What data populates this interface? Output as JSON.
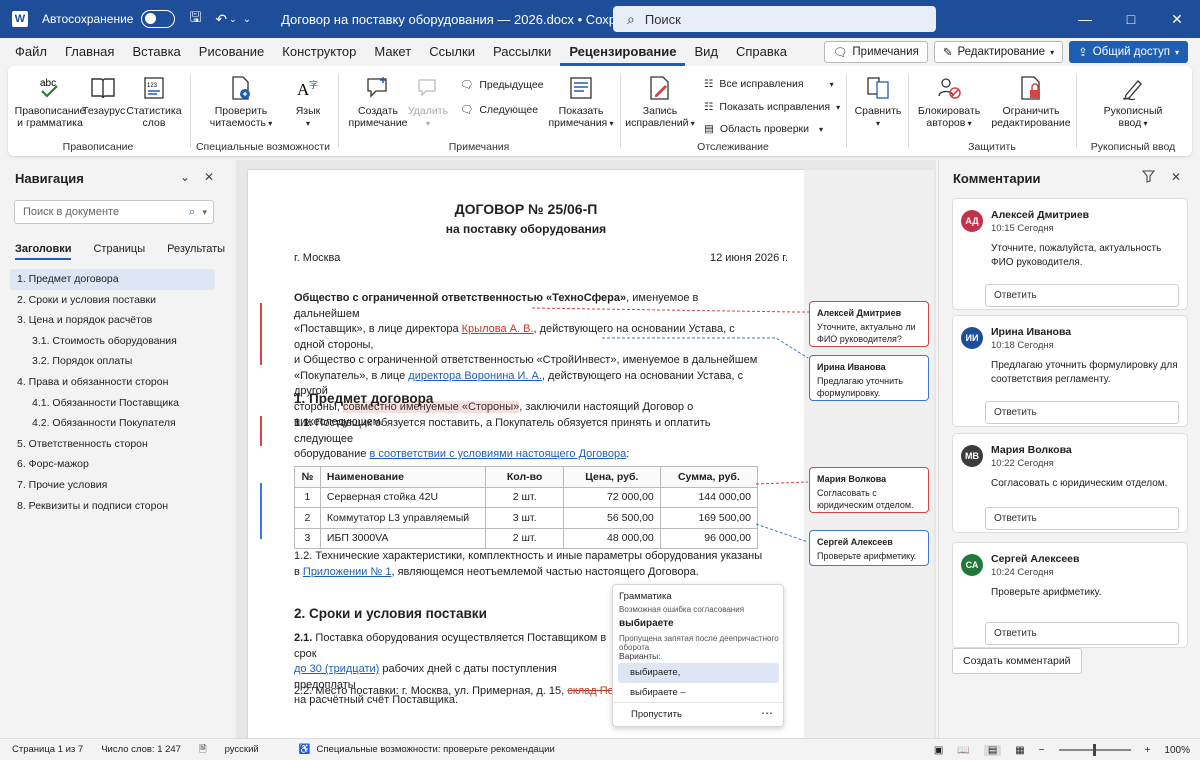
{
  "titlebar": {
    "autosave_label": "Автосохранение",
    "doc_title": "Договор на поставку оборудования — 2026.docx • Сохранено",
    "search_placeholder": "Поиск"
  },
  "menu": {
    "items": [
      "Файл",
      "Главная",
      "Вставка",
      "Рисование",
      "Конструктор",
      "Макет",
      "Ссылки",
      "Рассылки",
      "Рецензирование",
      "Вид",
      "Справка"
    ],
    "active": "Рецензирование",
    "comments_btn": "Примечания",
    "editing_btn": "Редактирование",
    "share_btn": "Общий доступ"
  },
  "ribbon": {
    "spelling": "Правописание\nи грамматика",
    "thesaurus": "Тезаурус",
    "stats": "Статистика\nслов",
    "g_proofing": "Правописание",
    "readability": "Проверить\nчитаемость",
    "g_access": "Специальные возможности",
    "language": "Язык",
    "new_comment": "Создать\nпримечание",
    "delete": "Удалить",
    "prev": "Предыдущее",
    "next": "Следующее",
    "show_comments": "Показать\nпримечания",
    "g_comments": "Примечания",
    "track": "Запись\nисправлений",
    "all_markup": "Все исправления",
    "show_markup": "Показать исправления",
    "review_pane": "Область проверки",
    "g_tracking": "Отслеживание",
    "compare": "Сравнить",
    "block": "Блокировать\nавторов",
    "restrict": "Ограничить\nредактирование",
    "g_protect": "Защитить",
    "ink": "Рукописный\nввод",
    "g_ink": "Рукописный ввод"
  },
  "nav": {
    "title": "Навигация",
    "search_placeholder": "Поиск в документе",
    "tabs": [
      "Заголовки",
      "Страницы",
      "Результаты"
    ],
    "items": [
      {
        "label": "1. Предмет договора",
        "level": 1,
        "selected": true
      },
      {
        "label": "2. Сроки и условия поставки",
        "level": 1
      },
      {
        "label": "3. Цена и порядок расчётов",
        "level": 1
      },
      {
        "label": "3.1. Стоимость оборудования",
        "level": 2
      },
      {
        "label": "3.2. Порядок оплаты",
        "level": 2
      },
      {
        "label": "4. Права и обязанности сторон",
        "level": 1
      },
      {
        "label": "4.1. Обязанности Поставщика",
        "level": 2
      },
      {
        "label": "4.2. Обязанности Покупателя",
        "level": 2
      },
      {
        "label": "5. Ответственность сторон",
        "level": 1
      },
      {
        "label": "6. Форс-мажор",
        "level": 1
      },
      {
        "label": "7. Прочие условия",
        "level": 1
      },
      {
        "label": "8. Реквизиты и подписи сторон",
        "level": 1
      }
    ]
  },
  "doc": {
    "title": "ДОГОВОР № 25/06-П",
    "subtitle": "на поставку оборудования",
    "city": "г. Москва",
    "date": "12 июня 2026 г.",
    "p1_org1": "Общество с ограниченной ответственностью «ТехноСфера»",
    "p1_a": ", именуемое в дальнейшем",
    "p1_b": "«Поставщик», в лице директора ",
    "p1_ins1": "Крылова А. В.",
    "p1_c": ", действующего на основании Устава, с одной стороны,",
    "p1_d": "и Общество с ограниченной ответственностью «СтройИнвест», именуемое в дальнейшем",
    "p1_e": "«Покупатель», в лице ",
    "p1_ins2": "директора Воронина И. А.",
    "p1_f": ", действующего на основании Устава, с другой",
    "p1_g": "стороны, ",
    "p1_hl": "совместно именуемые «Стороны»",
    "p1_h": ", заключили настоящий Договор о нижеследующем.",
    "h1": "1. Предмет договора",
    "s11_num": "1.1.",
    "s11_a": " Поставщик обязуется поставить, а Покупатель обязуется принять и оплатить следующее",
    "s11_b": "оборудование ",
    "s11_ins": "в соответствии с условиями настоящего Договора",
    "s11_c": ":",
    "table": {
      "headers": [
        "№",
        "Наименование",
        "Кол-во",
        "Цена, руб.",
        "Сумма, руб."
      ],
      "rows": [
        [
          "1",
          "Серверная стойка 42U",
          "2 шт.",
          "72 000,00",
          "144 000,00"
        ],
        [
          "2",
          "Коммутатор L3 управляемый",
          "3 шт.",
          "56 500,00",
          "169 500,00"
        ],
        [
          "3",
          "ИБП 3000VA",
          "2 шт.",
          "48 000,00",
          "96 000,00"
        ]
      ]
    },
    "s12_a": "1.2. Технические характеристики, комплектность и иные параметры оборудования указаны",
    "s12_b": "в ",
    "s12_ins": "Приложении № 1",
    "s12_c": ", являющемся неотъемлемой частью настоящего Договора.",
    "h2": "2. Сроки и условия поставки",
    "s21_num": "2.1.",
    "s21_a": " Поставка оборудования осуществляется Поставщиком в срок",
    "s21_ins": "до 30 (тридцати)",
    "s21_b": " рабочих дней с даты поступления предоплаты",
    "s21_c": "на расчётный счёт Поставщика.",
    "s22_a": "2.2. Место поставки: г. Москва, ул. Примерная, д. 15, ",
    "s22_del": "склад Покупателя"
  },
  "bubbles": [
    {
      "author": "Алексей Дмитриев",
      "text": "Уточните, актуально ли ФИО руководителя?",
      "color": "red"
    },
    {
      "author": "Ирина Иванова",
      "text": "Предлагаю уточнить формулировку.",
      "color": "blue"
    },
    {
      "author": "Мария Волкова",
      "text": "Согласовать с юридическим отделом.",
      "color": "red"
    },
    {
      "author": "Сергей Алексеев",
      "text": "Проверьте арифметику.",
      "color": "blue"
    }
  ],
  "grammar": {
    "title": "Грамматика",
    "kind": "Возможная ошибка согласования",
    "word": "выбираете",
    "desc": "Пропущена запятая после деепричастного оборота",
    "variants_label": "Варианты:",
    "options": [
      "выбираете,",
      "выбираете –"
    ],
    "skip": "Пропустить"
  },
  "comments": {
    "title": "Комментарии",
    "reply_label": "Ответить",
    "new_label": "Создать комментарий",
    "items": [
      {
        "initials": "АД",
        "author": "Алексей Дмитриев",
        "time": "10:15 Сегодня",
        "text": "Уточните, пожалуйста, актуальность ФИО руководителя.",
        "color": "#c4314b"
      },
      {
        "initials": "ИИ",
        "author": "Ирина Иванова",
        "time": "10:18 Сегодня",
        "text": "Предлагаю уточнить формулировку для соответствия регламенту.",
        "color": "#1e4e9a"
      },
      {
        "initials": "МВ",
        "author": "Мария Волкова",
        "time": "10:22 Сегодня",
        "text": "Согласовать с юридическим отделом.",
        "color": "#3c3c3c"
      },
      {
        "initials": "СА",
        "author": "Сергей Алексеев",
        "time": "10:24 Сегодня",
        "text": "Проверьте арифметику.",
        "color": "#1f7a3a"
      }
    ]
  },
  "status": {
    "page": "Страница 1 из 7",
    "words": "Число слов: 1 247",
    "lang": "русский",
    "access": "Специальные возможности: проверьте рекомендации",
    "zoom": "100%"
  },
  "colors": {
    "accent": "#1e5fb4",
    "titlebar": "#1e4e9a",
    "insert_red": "#c0392b"
  }
}
